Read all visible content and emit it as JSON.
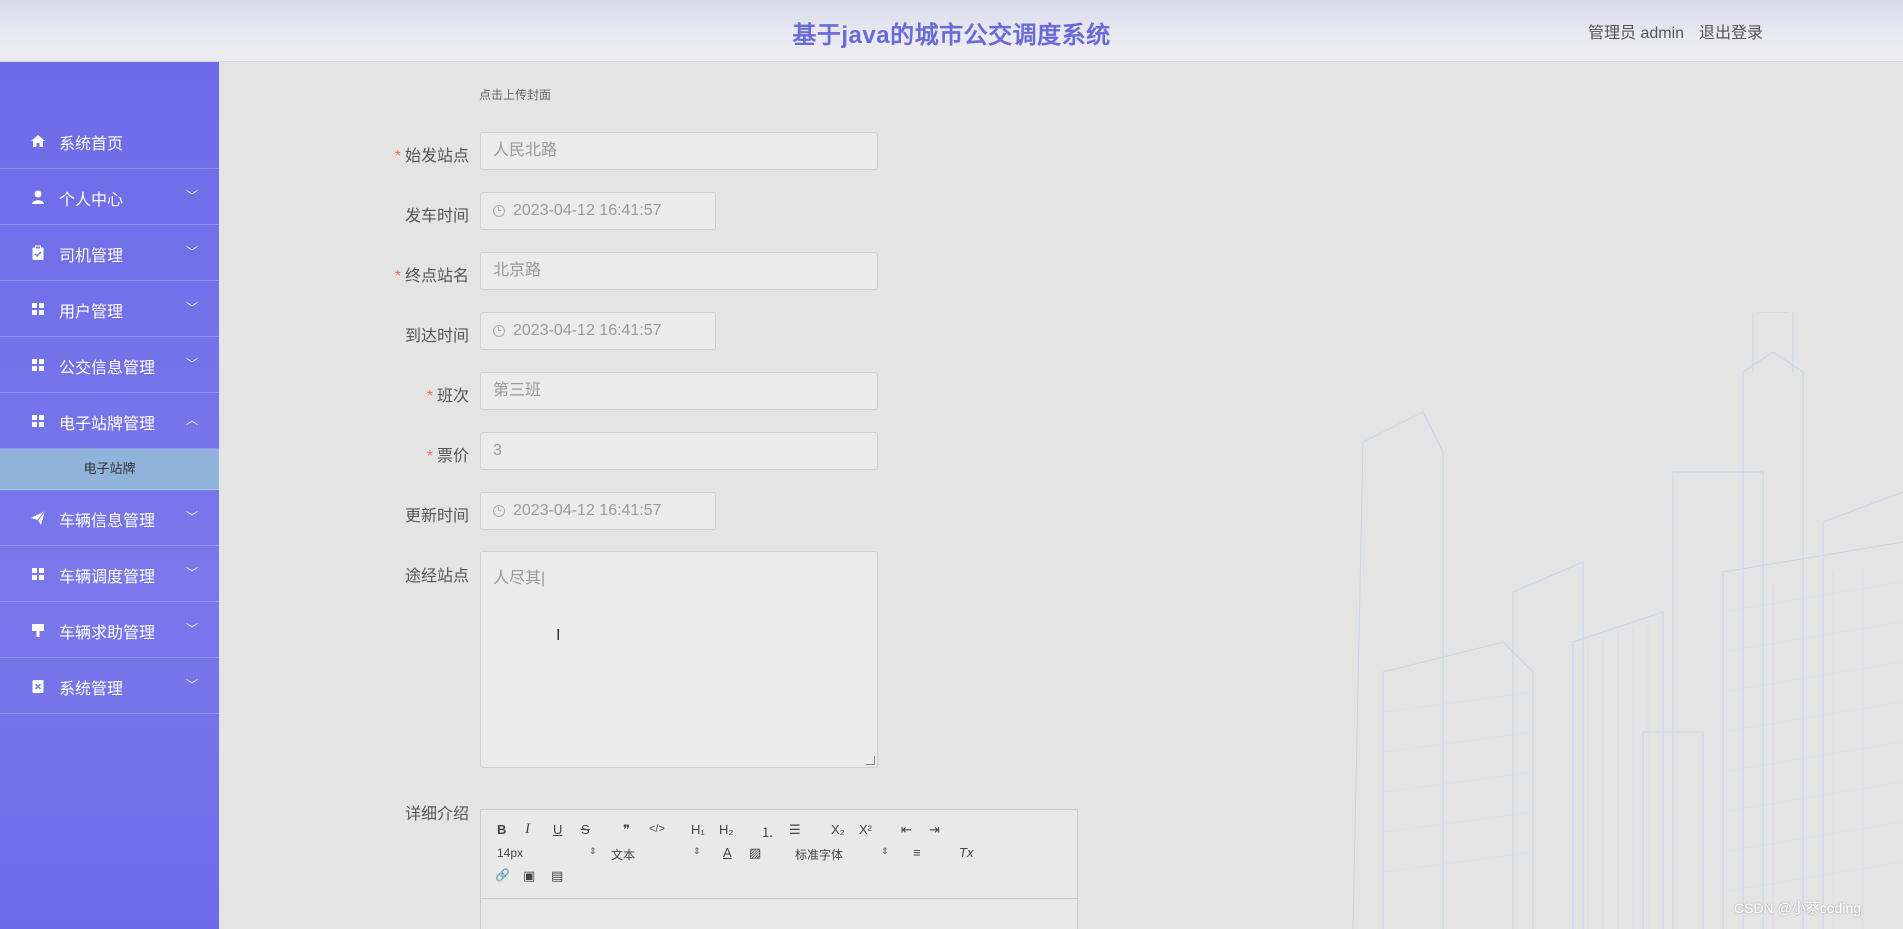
{
  "header": {
    "title": "基于java的城市公交调度系统",
    "user": "管理员 admin",
    "logout": "退出登录"
  },
  "sidebar": {
    "items": [
      {
        "label": "系统首页",
        "icon": "home-icon"
      },
      {
        "label": "个人中心",
        "icon": "user-icon"
      },
      {
        "label": "司机管理",
        "icon": "clipboard-icon"
      },
      {
        "label": "用户管理",
        "icon": "grid-icon"
      },
      {
        "label": "公交信息管理",
        "icon": "grid-icon"
      },
      {
        "label": "电子站牌管理",
        "icon": "grid-icon"
      },
      {
        "label": "车辆信息管理",
        "icon": "send-icon"
      },
      {
        "label": "车辆调度管理",
        "icon": "grid-icon"
      },
      {
        "label": "车辆求助管理",
        "icon": "stamp-icon"
      },
      {
        "label": "系统管理",
        "icon": "close-box-icon"
      }
    ],
    "submenu": {
      "label": "电子站牌"
    }
  },
  "form": {
    "upload_hint": "点击上传封面",
    "start_station": {
      "label": "始发站点",
      "value": "人民北路"
    },
    "depart_time": {
      "label": "发车时间",
      "value": "2023-04-12 16:41:57"
    },
    "end_station": {
      "label": "终点站名",
      "value": "北京路"
    },
    "arrive_time": {
      "label": "到达时间",
      "value": "2023-04-12 16:41:57"
    },
    "shift": {
      "label": "班次",
      "value": "第三班"
    },
    "fare": {
      "label": "票价",
      "value": "3"
    },
    "update_time": {
      "label": "更新时间",
      "value": "2023-04-12 16:41:57"
    },
    "via_stations": {
      "label": "途经站点",
      "value": "人尽其|"
    },
    "detail": {
      "label": "详细介绍"
    },
    "required_mark": "*"
  },
  "editor": {
    "font_size": "14px",
    "header_select": "文本",
    "font_family": "标准字体",
    "buttons": {
      "bold": "B",
      "italic": "I",
      "underline": "U",
      "strike": "S",
      "quote": "❞",
      "code": "</>",
      "h1": "H₁",
      "h2": "H₂",
      "ordered": "⒈",
      "bullet": "☰",
      "sub": "X₂",
      "sup": "X²",
      "outdent": "⇤",
      "indent": "⇥",
      "color": "A",
      "background": "▨",
      "align": "≡",
      "clean": "Tx",
      "link": "🔗",
      "image": "▣",
      "video": "▤"
    }
  },
  "watermark": "CSDN @小蔡coding",
  "colors": {
    "sidebar": "#6d6be8",
    "title": "#6a6ad8",
    "submenu": "#8fb3db",
    "required": "#f56c6c"
  }
}
